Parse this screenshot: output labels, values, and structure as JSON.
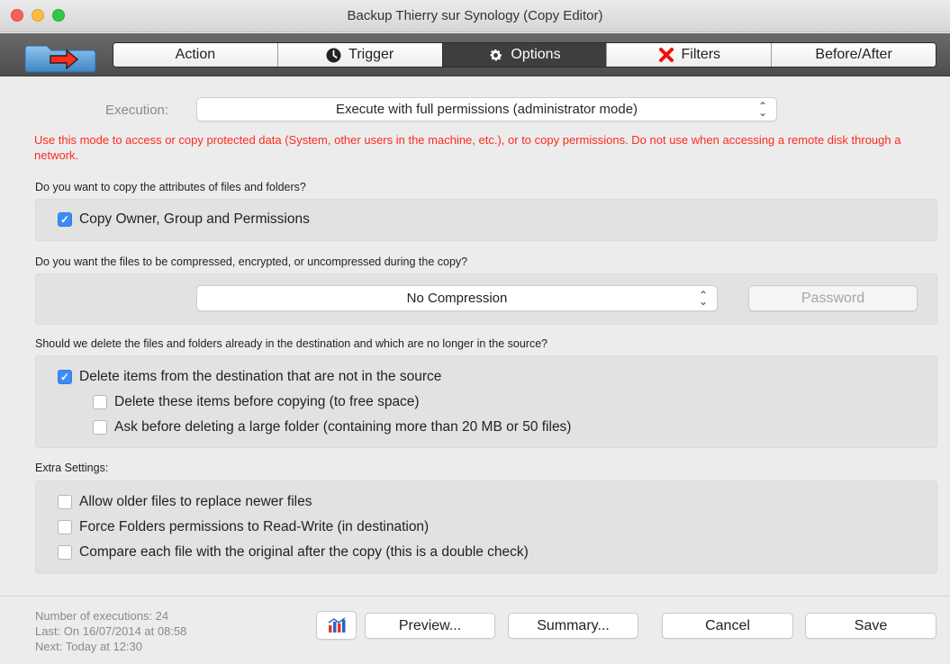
{
  "window": {
    "title": "Backup Thierry sur Synology (Copy Editor)"
  },
  "toolbar": {
    "tabs": [
      {
        "label": "Action",
        "icon": ""
      },
      {
        "label": "Trigger",
        "icon": "clock-icon"
      },
      {
        "label": "Options",
        "icon": "gear-icon"
      },
      {
        "label": "Filters",
        "icon": "red-x-icon"
      },
      {
        "label": "Before/After",
        "icon": ""
      }
    ],
    "active_tab": "Options"
  },
  "execution": {
    "label": "Execution:",
    "value": "Execute with full permissions (administrator mode)",
    "warning": "Use this mode to access or copy protected data (System, other users in the machine, etc.), or to copy permissions. Do not use when accessing a remote disk through a network."
  },
  "attributes": {
    "question": "Do you want to copy the attributes of files and folders?",
    "copy_owner": {
      "label": "Copy Owner, Group and Permissions",
      "checked": true
    }
  },
  "compression": {
    "question": "Do you want the files to be compressed, encrypted, or uncompressed during the copy?",
    "value": "No Compression",
    "password_label": "Password"
  },
  "deletion": {
    "question": "Should we delete the files and folders already in the destination and which are no longer in the source?",
    "delete_items": {
      "label": "Delete items from the destination that are not in the source",
      "checked": true
    },
    "delete_before": {
      "label": "Delete these items before copying (to free space)",
      "checked": false
    },
    "ask_before": {
      "label": "Ask before deleting a large folder (containing more than 20 MB or 50 files)",
      "checked": false
    }
  },
  "extra": {
    "label": "Extra Settings:",
    "allow_older": {
      "label": "Allow older files to replace newer files",
      "checked": false
    },
    "force_folders": {
      "label": "Force Folders permissions to Read-Write (in destination)",
      "checked": false
    },
    "compare": {
      "label": "Compare each file with the original after the copy (this is a double check)",
      "checked": false
    }
  },
  "footer": {
    "executions": "Number of executions: 24",
    "last": "Last: On 16/07/2014 at 08:58",
    "next": "Next: Today at 12:30",
    "preview_label": "Preview...",
    "summary_label": "Summary...",
    "cancel_label": "Cancel",
    "save_label": "Save"
  },
  "colors": {
    "warning": "#ff2a1e",
    "checkbox": "#3b8df5",
    "active_tab": "#3e3e3e"
  }
}
